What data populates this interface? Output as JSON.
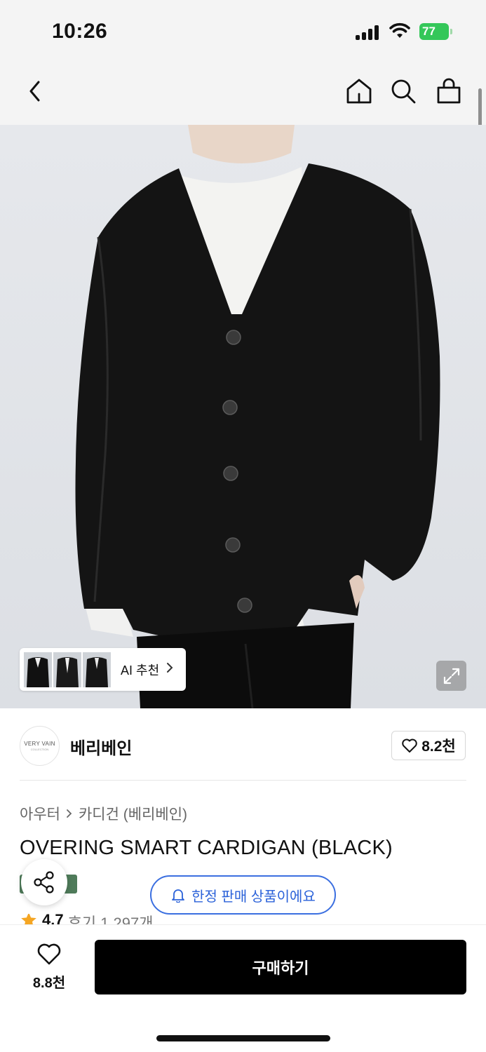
{
  "status_bar": {
    "time": "10:26",
    "battery": "77"
  },
  "nav": {
    "back_icon": "chevron-left-icon",
    "home_icon": "home-icon",
    "search_icon": "search-icon",
    "bag_icon": "shopping-bag-icon"
  },
  "hero": {
    "ai_recommend_label": "AI 추천",
    "expand_icon": "expand-icon"
  },
  "brand": {
    "logo_text": "VERY VAIN",
    "logo_subtext": "COLLECTION",
    "name": "베리베인",
    "like_count": "8.2천"
  },
  "product": {
    "breadcrumb": [
      "아우터",
      "카디건 (베리베인)"
    ],
    "title": "OVERING SMART CARDIGAN (BLACK)",
    "limited_notice": "한정 판매 상품이에요",
    "rating": "4.7",
    "reviews": "후기 1,297개"
  },
  "bottom_bar": {
    "wish_count": "8.8천",
    "buy_label": "구매하기"
  },
  "colors": {
    "accent_blue": "#2b62d9",
    "badge_green": "#4f7b5a",
    "battery_green": "#34c759",
    "star": "#f5a623",
    "buy_button": "#000000"
  }
}
